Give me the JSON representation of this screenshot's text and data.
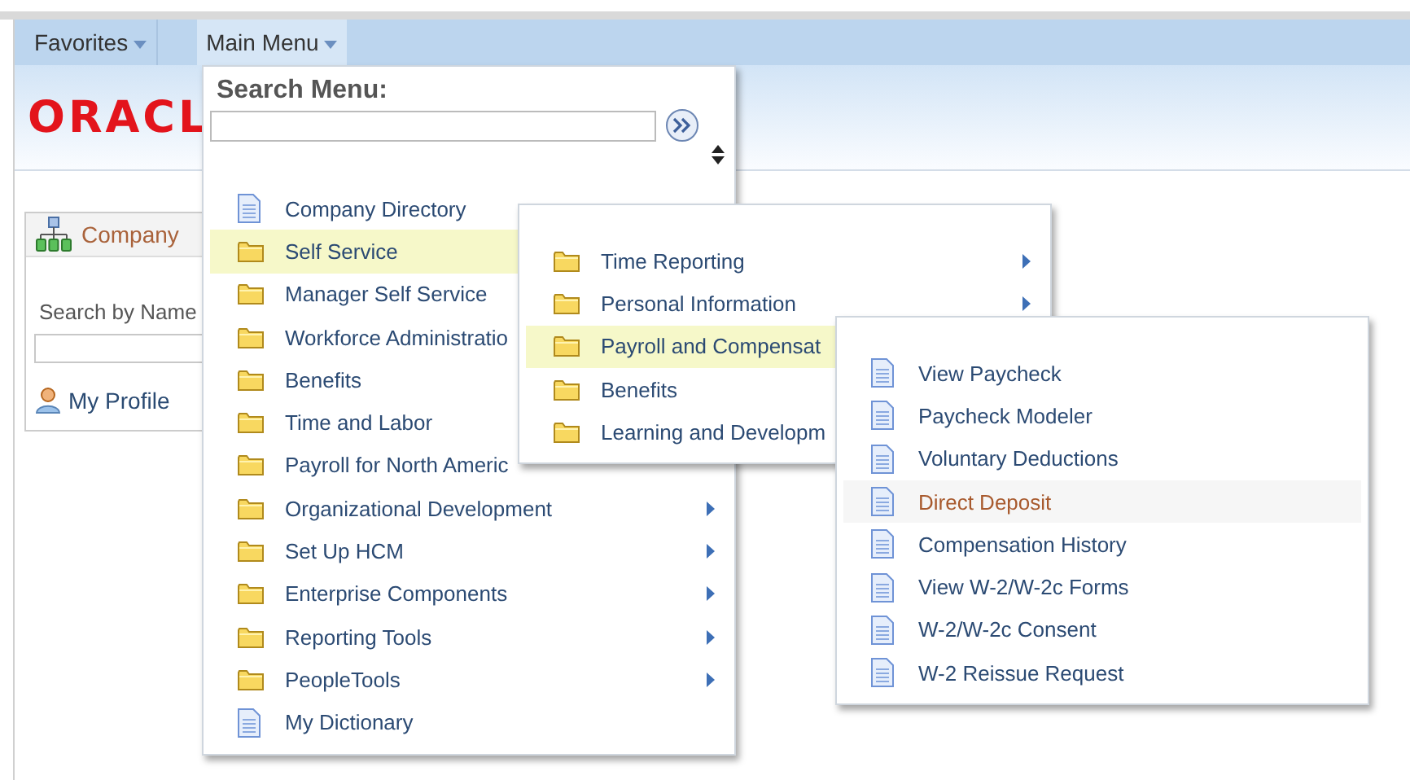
{
  "nav_tabs": [
    {
      "label": "Favorites",
      "selected": false
    },
    {
      "label": "Main Menu",
      "selected": true
    }
  ],
  "header": {
    "logo": "ORACL"
  },
  "pagelet": {
    "title": "Company",
    "search_label": "Search by Name",
    "link": "My Profile"
  },
  "main_menu": {
    "search_label": "Search Menu:",
    "items": [
      {
        "label": "Company Directory",
        "kind": "page",
        "selected": false,
        "hovered": false,
        "arrow": false
      },
      {
        "label": "Self Service",
        "kind": "folder",
        "selected": true,
        "hovered": false,
        "arrow": false
      },
      {
        "label": "Manager Self Service",
        "kind": "folder",
        "selected": false,
        "hovered": false,
        "arrow": false
      },
      {
        "label": "Workforce Administratio",
        "kind": "folder",
        "selected": false,
        "hovered": false,
        "arrow": false
      },
      {
        "label": "Benefits",
        "kind": "folder",
        "selected": false,
        "hovered": false,
        "arrow": false
      },
      {
        "label": "Time and Labor",
        "kind": "folder",
        "selected": false,
        "hovered": false,
        "arrow": false
      },
      {
        "label": "Payroll for North Americ",
        "kind": "folder",
        "selected": false,
        "hovered": false,
        "arrow": false
      },
      {
        "label": "Organizational Development",
        "kind": "folder",
        "selected": false,
        "hovered": false,
        "arrow": true
      },
      {
        "label": "Set Up HCM",
        "kind": "folder",
        "selected": false,
        "hovered": false,
        "arrow": true
      },
      {
        "label": "Enterprise Components",
        "kind": "folder",
        "selected": false,
        "hovered": false,
        "arrow": true
      },
      {
        "label": "Reporting Tools",
        "kind": "folder",
        "selected": false,
        "hovered": false,
        "arrow": true
      },
      {
        "label": "PeopleTools",
        "kind": "folder",
        "selected": false,
        "hovered": false,
        "arrow": true
      },
      {
        "label": "My Dictionary",
        "kind": "page",
        "selected": false,
        "hovered": false,
        "arrow": false
      }
    ]
  },
  "submenus": [
    {
      "items": [
        {
          "label": "Time Reporting",
          "kind": "folder",
          "selected": false,
          "hovered": false,
          "arrow": true
        },
        {
          "label": "Personal Information",
          "kind": "folder",
          "selected": false,
          "hovered": false,
          "arrow": true
        },
        {
          "label": "Payroll and Compensat",
          "kind": "folder",
          "selected": true,
          "hovered": false,
          "arrow": false
        },
        {
          "label": "Benefits",
          "kind": "folder",
          "selected": false,
          "hovered": false,
          "arrow": false
        },
        {
          "label": "Learning and Developm",
          "kind": "folder",
          "selected": false,
          "hovered": false,
          "arrow": false
        }
      ]
    },
    {
      "items": [
        {
          "label": "View Paycheck",
          "kind": "page",
          "selected": false,
          "hovered": false,
          "arrow": false
        },
        {
          "label": "Paycheck Modeler",
          "kind": "page",
          "selected": false,
          "hovered": false,
          "arrow": false
        },
        {
          "label": "Voluntary Deductions",
          "kind": "page",
          "selected": false,
          "hovered": false,
          "arrow": false
        },
        {
          "label": "Direct Deposit",
          "kind": "page",
          "selected": false,
          "hovered": true,
          "arrow": false
        },
        {
          "label": "Compensation History",
          "kind": "page",
          "selected": false,
          "hovered": false,
          "arrow": false
        },
        {
          "label": "View W-2/W-2c Forms",
          "kind": "page",
          "selected": false,
          "hovered": false,
          "arrow": false
        },
        {
          "label": "W-2/W-2c Consent",
          "kind": "page",
          "selected": false,
          "hovered": false,
          "arrow": false
        },
        {
          "label": "W-2 Reissue Request",
          "kind": "page",
          "selected": false,
          "hovered": false,
          "arrow": false
        }
      ]
    }
  ]
}
